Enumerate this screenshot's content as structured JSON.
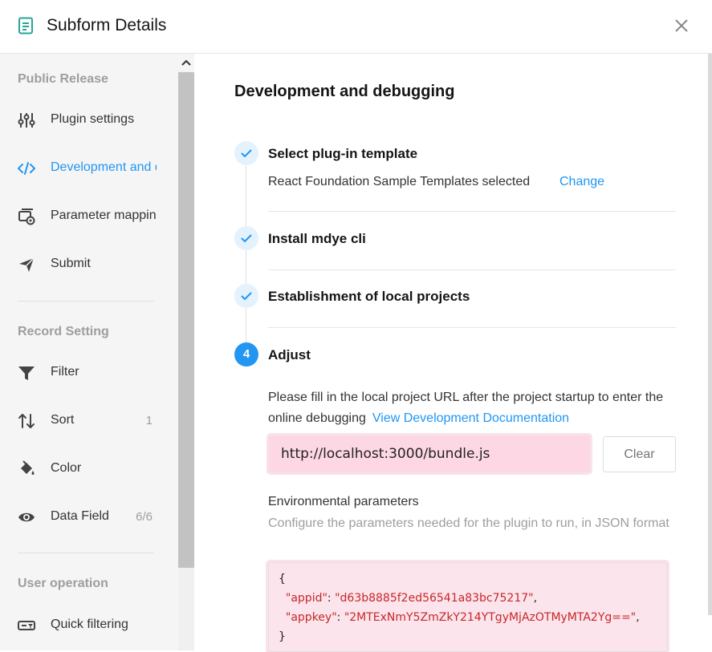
{
  "header": {
    "title": "Subform Details",
    "icons": {
      "doc": "document-icon",
      "close": "close-icon"
    }
  },
  "sidebar": {
    "group_public": "Public Release",
    "group_record": "Record Setting",
    "group_user": "User operation",
    "items": [
      {
        "label": "Plugin settings",
        "icon": "sliders-icon"
      },
      {
        "label": "Development and debugging",
        "icon": "code-icon",
        "active": true
      },
      {
        "label": "Parameter mapping",
        "icon": "parameter-icon"
      },
      {
        "label": "Submit",
        "icon": "send-icon"
      },
      {
        "label": "Filter",
        "icon": "filter-icon"
      },
      {
        "label": "Sort",
        "icon": "sort-icon",
        "count": "1"
      },
      {
        "label": "Color",
        "icon": "paint-bucket-icon"
      },
      {
        "label": "Data Field",
        "icon": "eye-icon",
        "count": "6/6"
      },
      {
        "label": "Quick filtering",
        "icon": "quick-filter-icon"
      }
    ]
  },
  "main": {
    "title": "Development and debugging",
    "steps": [
      {
        "title": "Select plug-in template",
        "status": "done"
      },
      {
        "title": "Install mdye cli",
        "status": "done"
      },
      {
        "title": "Establishment of local projects",
        "status": "done"
      },
      {
        "title": "Adjust",
        "status": "current",
        "number": "4"
      }
    ],
    "template_selected": "React Foundation Sample Templates selected",
    "change_label": "Change",
    "adjust_desc": "Please fill in the local project URL after the project startup to enter the online debugging",
    "doc_link": "View Development Documentation",
    "url_value": "http://localhost:3000/bundle.js",
    "clear_label": "Clear",
    "env_title": "Environmental parameters",
    "env_desc": "Configure the parameters needed for the plugin to run, in JSON format",
    "json": {
      "open": "{",
      "close": "}",
      "entries": [
        {
          "key": "\"appid\"",
          "value": "\"d63b8885f2ed56541a83bc75217\""
        },
        {
          "key": "\"appkey\"",
          "value": "\"2MTExNmY5ZmZkY214YTgyMjAzOTMyMTA2Yg==\""
        }
      ]
    }
  },
  "colors": {
    "accent": "#2196f3",
    "highlight": "#fdd7e3"
  }
}
